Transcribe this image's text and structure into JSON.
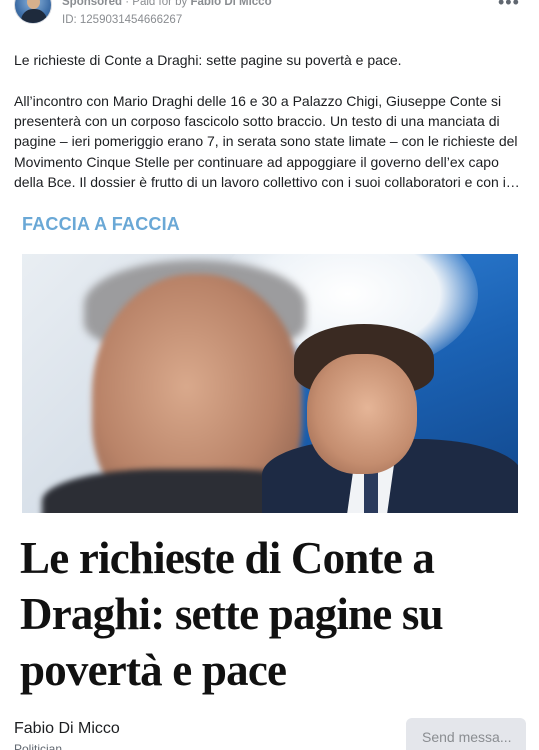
{
  "header": {
    "sponsored_label": "Sponsored",
    "separator": " · Paid for by ",
    "payer": "Fabio Di Micco",
    "ad_id": "ID: 1259031454666267",
    "more_icon": "more-horizontal-icon"
  },
  "post": {
    "headline": "Le richieste di Conte a Draghi: sette pagine su povertà e pace.",
    "body": "All’incontro con Mario Draghi delle 16 e 30 a Palazzo Chigi, Giuseppe Conte si presenterà con un corposo fascicolo sotto braccio. Un testo di una manciata di pagine – ieri pomeriggio erano 7, in serata sono state limate – con le richieste del Movimento Cinque Stelle per continuare ad appoggiare il governo dell’ex capo della Bce. Il dossier è frutto di un lavoro collettivo con i suoi collaboratori e con i…"
  },
  "creative": {
    "kicker": "FACCIA A FACCIA",
    "title": "Le richieste di Conte a Draghi: sette pagine su povertà e pace",
    "accent_color": "#6aa8d6"
  },
  "footer": {
    "page_name": "Fabio Di Micco",
    "page_category": "Politician",
    "send_button_label": "Send messa..."
  }
}
